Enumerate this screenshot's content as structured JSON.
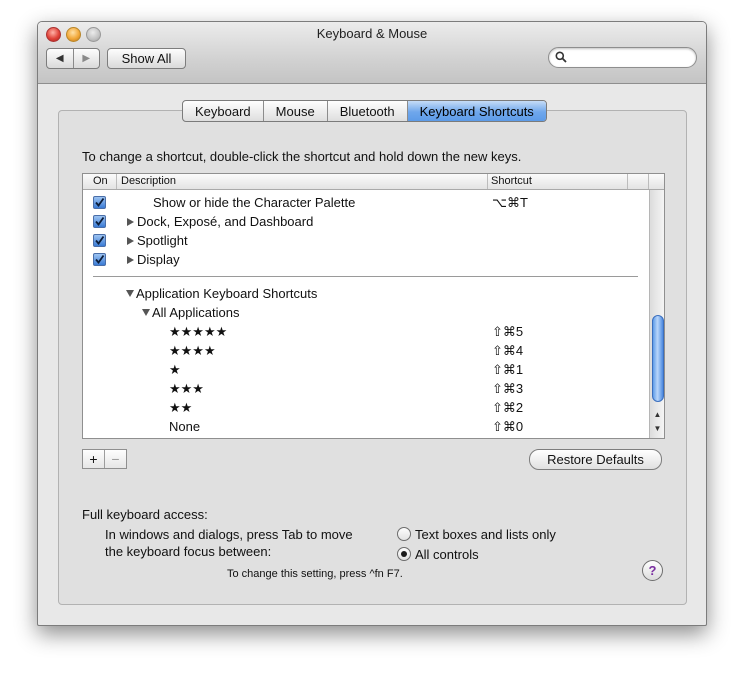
{
  "window": {
    "title": "Keyboard & Mouse",
    "nav_back": "◀",
    "nav_forward": "▶",
    "show_all": "Show All",
    "search_placeholder": ""
  },
  "tabs": [
    {
      "label": "Keyboard",
      "active": false
    },
    {
      "label": "Mouse",
      "active": false
    },
    {
      "label": "Bluetooth",
      "active": false
    },
    {
      "label": "Keyboard Shortcuts",
      "active": true
    }
  ],
  "instructions": "To change a shortcut, double-click the shortcut and hold down the new keys.",
  "table": {
    "columns": {
      "on": "On",
      "description": "Description",
      "shortcut": "Shortcut"
    },
    "rows_top": [
      {
        "checked": true,
        "label": "Show or hide the Character Palette",
        "shortcut": "⌥⌘T"
      },
      {
        "checked": true,
        "label": "Dock, Exposé, and Dashboard",
        "shortcut": ""
      },
      {
        "checked": true,
        "label": "Spotlight",
        "shortcut": ""
      },
      {
        "checked": true,
        "label": "Display",
        "shortcut": ""
      }
    ],
    "app_group": "Application Keyboard Shortcuts",
    "all_apps": "All Applications",
    "rows_app": [
      {
        "label": "★★★★★",
        "shortcut": "⇧⌘5"
      },
      {
        "label": "★★★★",
        "shortcut": "⇧⌘4"
      },
      {
        "label": "★",
        "shortcut": "⇧⌘1"
      },
      {
        "label": "★★★",
        "shortcut": "⇧⌘3"
      },
      {
        "label": "★★",
        "shortcut": "⇧⌘2"
      },
      {
        "label": "None",
        "shortcut": "⇧⌘0"
      }
    ]
  },
  "buttons": {
    "add": "+",
    "remove": "−",
    "restore": "Restore Defaults"
  },
  "keyboard_access": {
    "heading": "Full keyboard access:",
    "line1": "In windows and dialogs, press Tab to move",
    "line2": "the keyboard focus between:",
    "option_text": "Text boxes and lists only",
    "option_all": "All controls",
    "selected": "All controls",
    "hint": "To change this setting, press ^fn F7."
  },
  "help": "?"
}
